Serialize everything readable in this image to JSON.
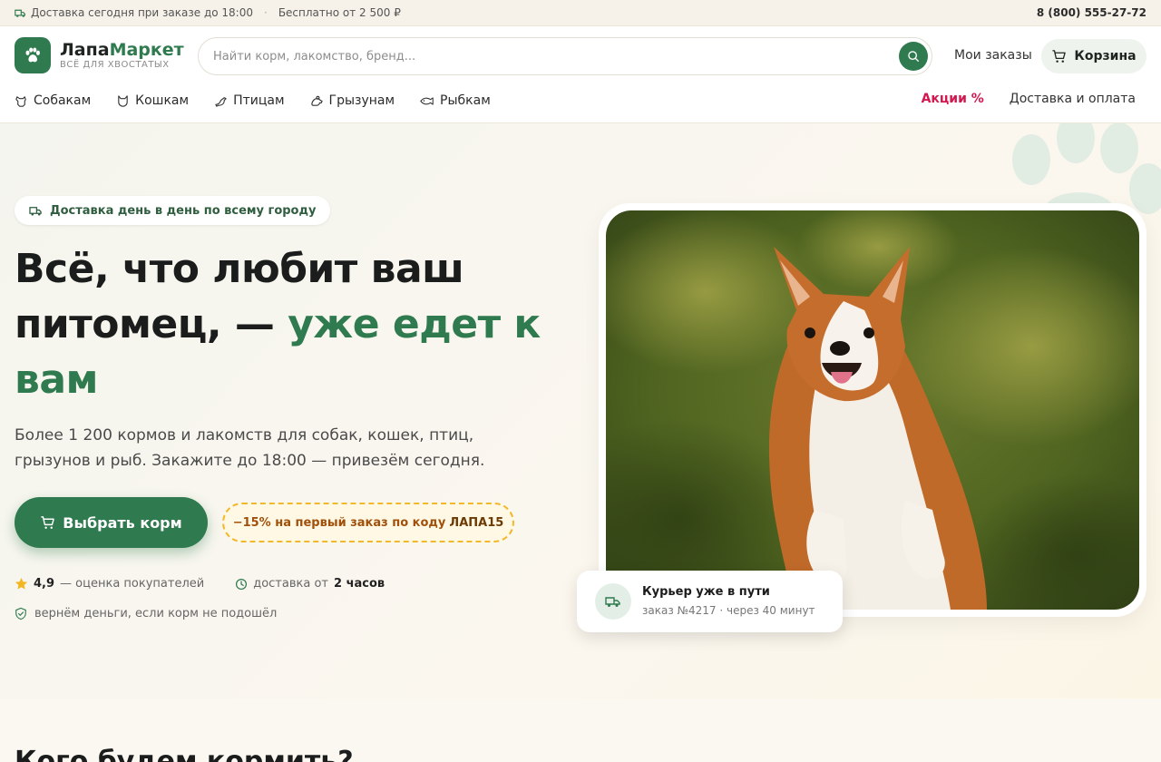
{
  "topbar": {
    "delivery_note": "Доставка сегодня при заказе до 18:00",
    "separator": "·",
    "free_note": "Бесплатно от 2 500 ₽",
    "phone": "8 (800) 555-27-72"
  },
  "brand": {
    "name_part1": "Лапа",
    "name_part2": "Маркет",
    "tagline": "ВСЁ ДЛЯ ХВОСТАТЫХ",
    "accent_color": "#2f7a4e"
  },
  "search": {
    "placeholder": "Найти корм, лакомство, бренд...",
    "value": ""
  },
  "header": {
    "orders_label": "Мои заказы",
    "cart_label": "Корзина"
  },
  "nav": {
    "items": [
      {
        "label": "Собакам",
        "icon": "dog-icon"
      },
      {
        "label": "Кошкам",
        "icon": "cat-icon"
      },
      {
        "label": "Птицам",
        "icon": "bird-icon"
      },
      {
        "label": "Грызунам",
        "icon": "rodent-icon"
      },
      {
        "label": "Рыбкам",
        "icon": "fish-icon"
      }
    ],
    "promo_label": "Акции %",
    "delivery_label": "Доставка и оплата"
  },
  "hero": {
    "pill": "Доставка день в день по всему городу",
    "title_line1": "Всё, что любит ваш",
    "title_line2_dark": "питомец, — ",
    "title_line2_green": "уже едет к",
    "title_line3_green": "вам",
    "subtitle": "Более 1 200 кормов и лакомств для собак, кошек, птиц, грызунов и рыб. Закажите до 18:00 — привезём сегодня.",
    "cta_label": "Выбрать корм",
    "coupon_text": "−15% на первый заказ по коду",
    "coupon_code": "ЛАПА15",
    "rating_value": "4,9",
    "rating_text": "— оценка покупателей",
    "delivery_prefix": "доставка от",
    "delivery_time": "2 часов",
    "guarantee": "вернём деньги, если корм не подошёл"
  },
  "courier": {
    "title": "Курьер уже в пути",
    "subtitle": "заказ №4217 · через 40 минут"
  },
  "section": {
    "title": "Кого будем кормить?"
  }
}
